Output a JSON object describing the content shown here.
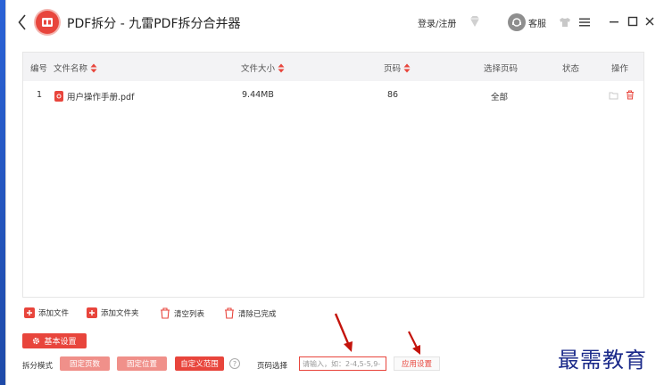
{
  "app": {
    "title": "PDF拆分 - 九雷PDF拆分合并器",
    "login": "登录/注册",
    "service": "客服"
  },
  "table": {
    "headers": {
      "index": "编号",
      "name": "文件名称",
      "size": "文件大小",
      "pages": "页码",
      "select": "选择页码",
      "status": "状态",
      "action": "操作"
    },
    "rows": [
      {
        "index": "1",
        "name": "用户操作手册.pdf",
        "size": "9.44MB",
        "pages": "86",
        "select": "全部",
        "status": ""
      }
    ]
  },
  "actions": {
    "add_file": "添加文件",
    "add_folder": "添加文件夹",
    "clear_list": "清空列表",
    "clear_done": "清除已完成"
  },
  "settings": {
    "basic": "基本设置",
    "mode_label": "拆分模式",
    "modes": [
      "固定页数",
      "固定位置",
      "自定义范围"
    ],
    "active_mode": "自定义范围",
    "page_select_label": "页码选择",
    "page_input_placeholder": "请输入，如：2-4,5-5,9-",
    "page_input_value": "",
    "apply": "应用设置"
  },
  "watermark": "最需教育",
  "colors": {
    "accent": "#e8453c",
    "accent_light": "#f0908a",
    "desktop": "#1f4fb8",
    "watermark": "#1b2a8a"
  }
}
